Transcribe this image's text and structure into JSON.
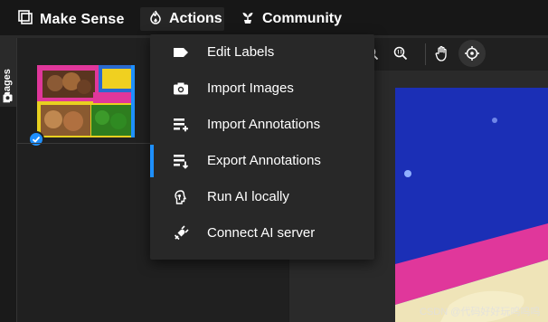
{
  "app": {
    "title": "Make Sense"
  },
  "nav": {
    "actions_label": "Actions",
    "community_label": "Community"
  },
  "sidebar": {
    "images_tab_label": "Images"
  },
  "actions_menu": {
    "items": [
      {
        "label": "Edit Labels",
        "icon": "label-tag-icon"
      },
      {
        "label": "Import Images",
        "icon": "camera-icon"
      },
      {
        "label": "Import Annotations",
        "icon": "import-annotations-icon"
      },
      {
        "label": "Export Annotations",
        "icon": "export-annotations-icon",
        "highlighted": true
      },
      {
        "label": "Run AI locally",
        "icon": "ai-local-icon"
      },
      {
        "label": "Connect AI server",
        "icon": "ai-server-icon"
      }
    ]
  },
  "toolbar": {
    "tools": [
      "zoom-in-icon",
      "zoom-fit-icon",
      "hand-icon",
      "crosshair-icon"
    ],
    "active_tool": "crosshair-icon"
  },
  "watermark": {
    "text": "CSDN @代码好好玩呜呜呜"
  },
  "colors": {
    "accent": "#1e90ff",
    "topbar_bg": "#171717",
    "menu_bg": "#282828",
    "canvas_blue": "#1b2fb6",
    "canvas_pink": "#e0379b"
  }
}
